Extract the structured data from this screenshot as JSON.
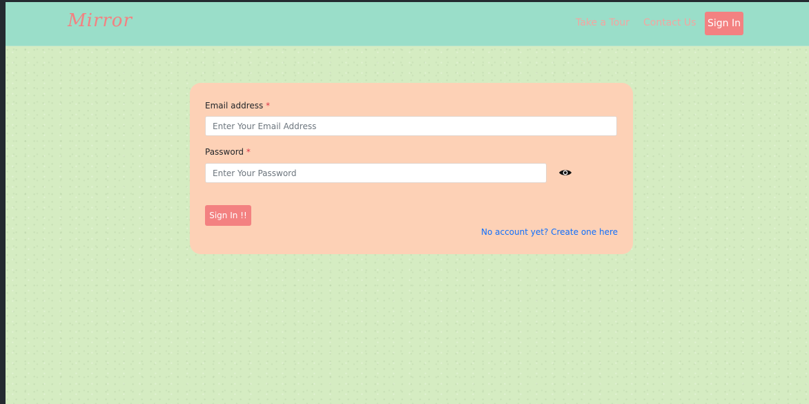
{
  "navbar": {
    "brand": "Mirror",
    "links": {
      "tour": "Take a Tour",
      "contact": "Contact Us"
    },
    "signin_label": "Sign In"
  },
  "form": {
    "email": {
      "label": "Email address",
      "required_mark": "*",
      "placeholder": "Enter Your Email Address",
      "value": ""
    },
    "password": {
      "label": "Password",
      "required_mark": "*",
      "placeholder": "Enter Your Password",
      "value": ""
    },
    "submit_label": "Sign In !!",
    "create_account_link": "No account yet? Create one here"
  },
  "icons": {
    "show_password": "eye-icon"
  },
  "colors": {
    "navbar_bg": "#9adec9",
    "brand": "#f38181",
    "nav_link": "#f3a5a0",
    "button": "#f38181",
    "card_bg": "#fdd1b6",
    "page_bg": "#d5ecc2",
    "link": "#0d6efd",
    "required": "#dc3545"
  }
}
